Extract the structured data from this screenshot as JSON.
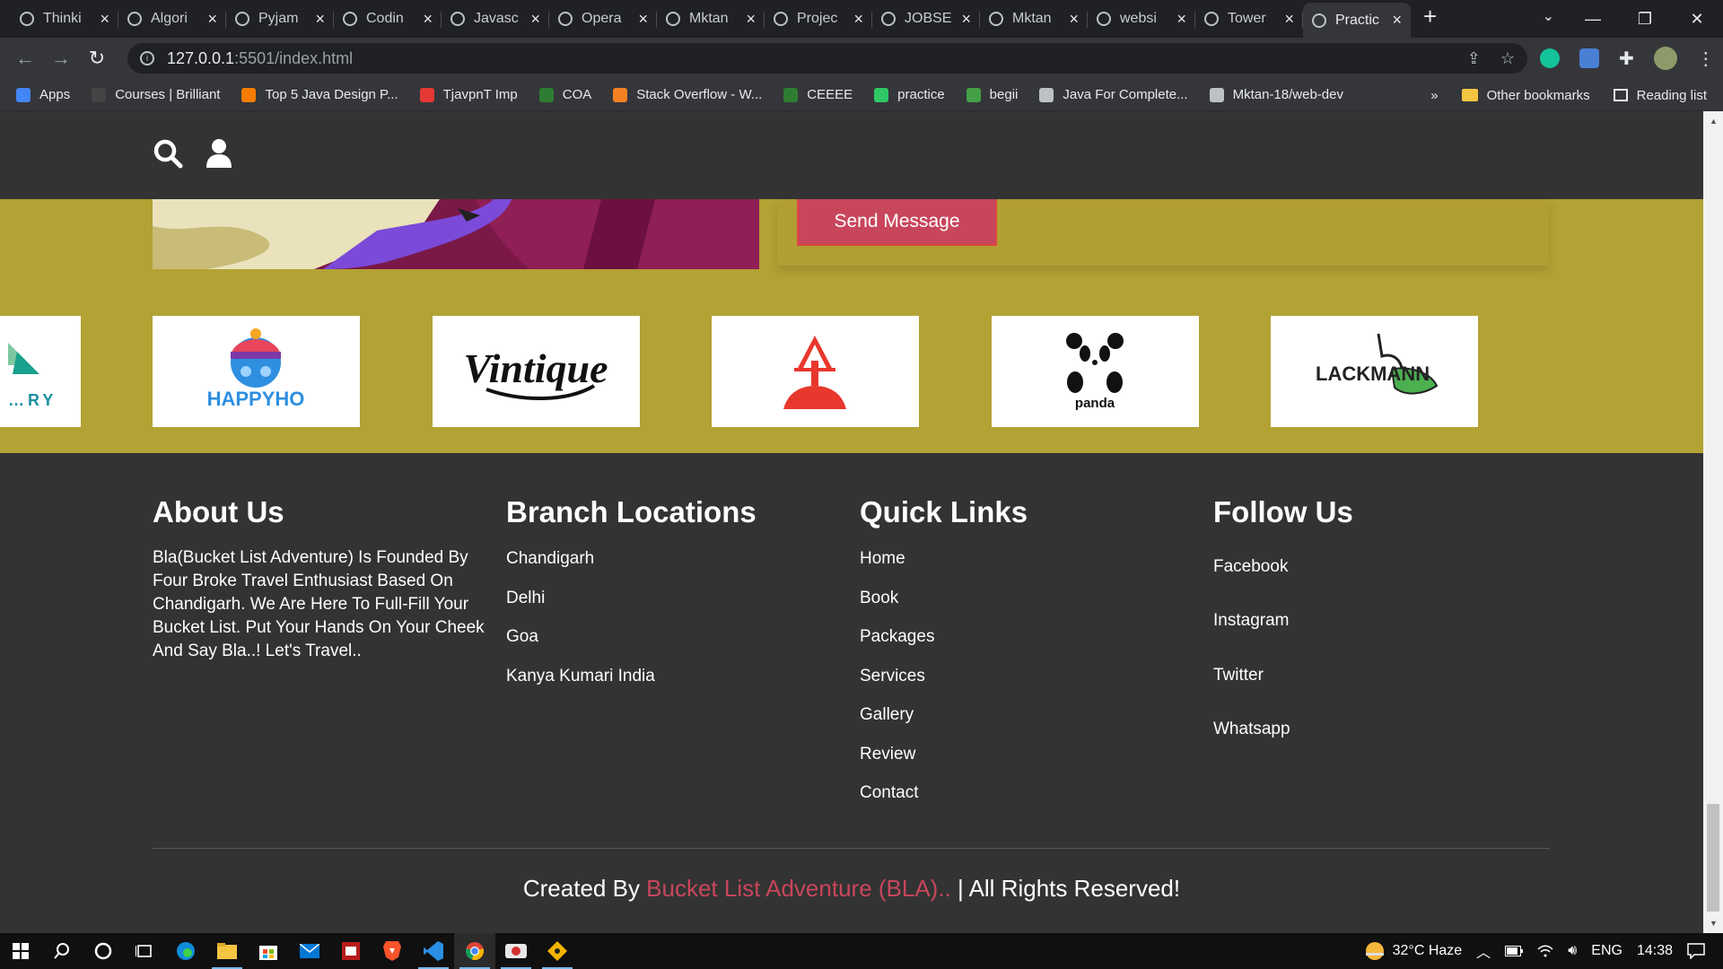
{
  "browser": {
    "tabs": [
      {
        "title": "Thinki",
        "active": false
      },
      {
        "title": "Algori",
        "active": false
      },
      {
        "title": "Pyjam",
        "active": false
      },
      {
        "title": "Codin",
        "active": false
      },
      {
        "title": "Javasc",
        "active": false
      },
      {
        "title": "Opera",
        "active": false
      },
      {
        "title": "Mktan",
        "active": false
      },
      {
        "title": "Projec",
        "active": false
      },
      {
        "title": "JOBSE",
        "active": false
      },
      {
        "title": "Mktan",
        "active": false
      },
      {
        "title": "websi",
        "active": false
      },
      {
        "title": "Tower",
        "active": false
      },
      {
        "title": "Practic",
        "active": true
      }
    ],
    "url_host": "127.0.0.1",
    "url_path": ":5501/index.html",
    "bookmarks": [
      {
        "label": "Apps",
        "color": "#4285f4"
      },
      {
        "label": "Courses | Brilliant",
        "color": "#444444"
      },
      {
        "label": "Top 5 Java Design P...",
        "color": "#f57c00"
      },
      {
        "label": "TjavpnT Imp",
        "color": "#e53935"
      },
      {
        "label": "COA",
        "color": "#2e7d32"
      },
      {
        "label": "Stack Overflow - W...",
        "color": "#f48024"
      },
      {
        "label": "CEEEE",
        "color": "#2e7d32"
      },
      {
        "label": "practice",
        "color": "#2ec866"
      },
      {
        "label": "begii",
        "color": "#43a047"
      },
      {
        "label": "Java For Complete...",
        "color": "#bdc1c6"
      },
      {
        "label": "Mktan-18/web-dev",
        "color": "#bdc1c6"
      }
    ],
    "bookmarks_more": "»",
    "other_bookmarks": "Other bookmarks",
    "reading_list": "Reading list"
  },
  "page": {
    "send_button": "Send Message",
    "partners": [
      {
        "name": "…RY",
        "logo": "partial-logo"
      },
      {
        "name": "HAPPYHO",
        "logo": "happyho-logo"
      },
      {
        "name": "Vintique",
        "logo": "vintique-logo"
      },
      {
        "name": "",
        "logo": "red-tower-logo"
      },
      {
        "name": "panda",
        "logo": "panda-logo"
      },
      {
        "name": "LACKMANN",
        "logo": "lackmann-logo"
      }
    ],
    "footer": {
      "about": {
        "title": "About Us",
        "text": "Bla(Bucket List Adventure) Is Founded By Four Broke Travel Enthusiast Based On Chandigarh. We Are Here To Full-Fill Your Bucket List. Put Your Hands On Your Cheek And Say Bla..! Let's Travel.."
      },
      "branches": {
        "title": "Branch Locations",
        "items": [
          "Chandigarh",
          "Delhi",
          "Goa",
          "Kanya Kumari India"
        ]
      },
      "quick_links": {
        "title": "Quick Links",
        "items": [
          "Home",
          "Book",
          "Packages",
          "Services",
          "Gallery",
          "Review",
          "Contact"
        ]
      },
      "follow": {
        "title": "Follow Us",
        "items": [
          "Facebook",
          "Instagram",
          "Twitter",
          "Whatsapp"
        ]
      },
      "credit_prefix": "Created By ",
      "credit_brand": "Bucket List Adventure (BLA)..",
      "credit_suffix": " | All Rights Reserved!"
    },
    "colors": {
      "accent": "#c8465c",
      "band": "#b3a234",
      "dark": "#333333"
    }
  },
  "taskbar": {
    "weather": "32°C  Haze",
    "lang": "ENG",
    "time": "14:38"
  }
}
